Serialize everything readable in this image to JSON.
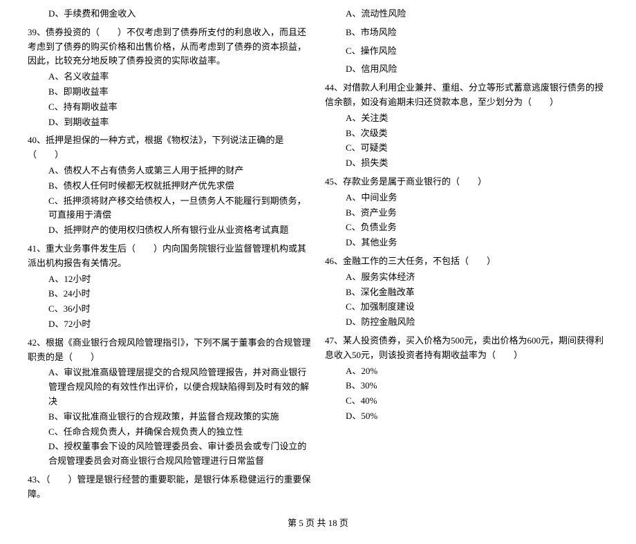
{
  "questions": {
    "left": [
      {
        "id": "q-d-prev",
        "text": "D、手续费和佣金收入",
        "options": []
      },
      {
        "id": "q39",
        "text": "39、债券投资的（　　）不仅考虑到了债券所支付的利息收入，而且还考虑到了债券的购买价格和出售价格，从而考虑到了债券的资本损益，因此，比较充分地反映了债券投资的实际收益率。",
        "options": [
          "A、名义收益率",
          "B、即期收益率",
          "C、持有期收益率",
          "D、到期收益率"
        ]
      },
      {
        "id": "q40",
        "text": "40、抵押是担保的一种方式，根据《物权法》，下列说法正确的是（　　）",
        "options": [
          "A、债权人不占有债务人或第三人用于抵押的财产",
          "B、债权人任何时候都无权就抵押财产优先求偿",
          "C、抵押须将财产移交给债权人，一旦债务人不能履行到期债务，可直接用于清偿",
          "D、抵押财产的使用权归债权人所有银行业从业资格考试真题"
        ]
      },
      {
        "id": "q41",
        "text": "41、重大业务事件发生后（　　）内向国务院银行业监督管理机构或其派出机构报告有关情况。",
        "options": [
          "A、12小时",
          "B、24小时",
          "C、36小时",
          "D、72小时"
        ]
      },
      {
        "id": "q42",
        "text": "42、根据《商业银行合规风险管理指引》，下列不属于董事会的合规管理职责的是（　　）",
        "options": [
          "A、审议批准高级管理层提交的合规风险管理报告，并对商业银行管理合规风险的有效性作出评价，以便合规缺陷得到及时有效的解决",
          "B、审议批准商业银行的合规政策，并监督合规政策的实施",
          "C、任命合规负责人，并确保合规负责人的独立性",
          "D、授权董事会下设的风险管理委员会、审计委员会或专门设立的合规管理委员会对商业银行合规风险管理进行日常监督"
        ]
      },
      {
        "id": "q43",
        "text": "43、（　　）管理是银行经营的重要职能，是银行体系稳健运行的重要保障。",
        "options": []
      }
    ],
    "right": [
      {
        "id": "q-a-prev",
        "text": "A、流动性风险",
        "options": []
      },
      {
        "id": "q-b-prev",
        "text": "B、市场风险",
        "options": []
      },
      {
        "id": "q-c-prev",
        "text": "C、操作风险",
        "options": []
      },
      {
        "id": "q-d-prev2",
        "text": "D、信用风险",
        "options": []
      },
      {
        "id": "q44",
        "text": "44、对借款人利用企业兼并、重组、分立等形式蓄意逃废银行债务的授信余额，如没有逾期未归还贷款本息，至少划分为（　　）",
        "options": [
          "A、关注类",
          "B、次级类",
          "C、可疑类",
          "D、损失类"
        ]
      },
      {
        "id": "q45",
        "text": "45、存款业务是属于商业银行的（　　）",
        "options": [
          "A、中间业务",
          "B、资产业务",
          "C、负债业务",
          "D、其他业务"
        ]
      },
      {
        "id": "q46",
        "text": "46、金融工作的三大任务，不包括（　　）",
        "options": [
          "A、服务实体经济",
          "B、深化金融改革",
          "C、加强制度建设",
          "D、防控金融风险"
        ]
      },
      {
        "id": "q47",
        "text": "47、某人投资债券，买入价格为500元，卖出价格为600元，期间获得利息收入50元，则该投资者持有期收益率为（　　）",
        "options": [
          "A、20%",
          "B、30%",
          "C、40%",
          "D、50%"
        ]
      }
    ]
  },
  "footer": {
    "page_info": "第 5 页 共 18 页"
  }
}
